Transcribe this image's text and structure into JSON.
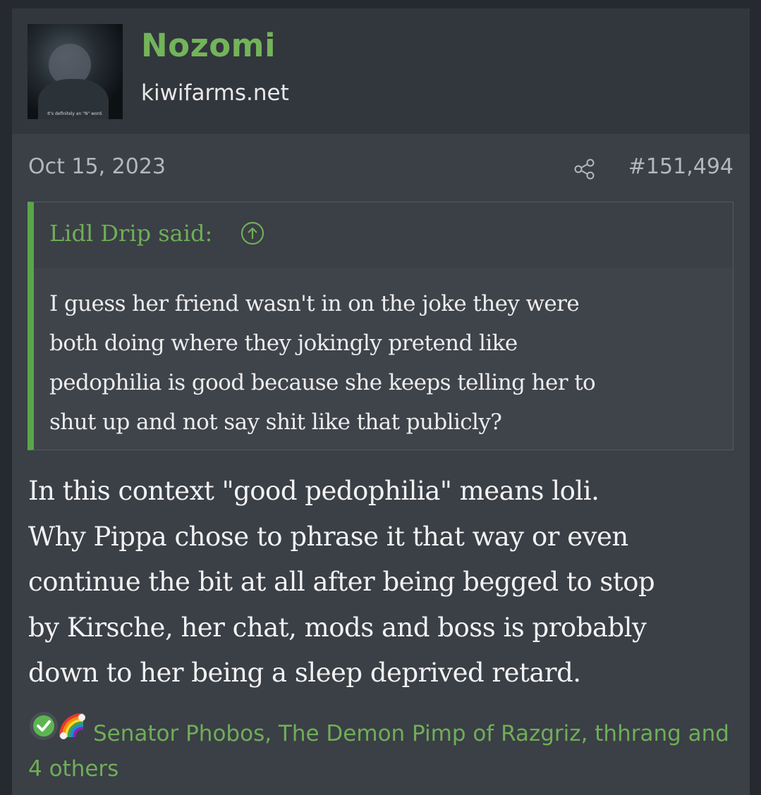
{
  "user": {
    "name": "Nozomi",
    "site": "kiwifarms.net",
    "avatar_caption": "It's definitely an \"N\" word."
  },
  "post": {
    "date": "Oct 15, 2023",
    "number": "#151,494",
    "share_icon": "share-icon"
  },
  "quote": {
    "author": "Lidl Drip said:",
    "arrow_icon": "arrow-up-circle-icon",
    "lines": [
      "I guess her friend wasn't in on the joke they were",
      "both doing where they jokingly pretend like",
      "pedophilia is good because she keeps telling her to",
      "shut up and not say shit like that publicly?"
    ]
  },
  "message": {
    "lines": [
      "In this context \"good pedophilia\" means loli.",
      "Why Pippa chose to phrase it that way or even",
      "continue the bit at all after being begged to stop",
      "by Kirsche, her chat, mods and boss is probably",
      "down to her being a sleep deprived retard."
    ]
  },
  "reactions": {
    "icons": [
      "check-icon",
      "rainbow-icon"
    ],
    "text": "Senator Phobos, The Demon Pimp of Razgriz, thhrang and 4 others"
  },
  "colors": {
    "accent_green": "#73b45a",
    "quote_bar": "#59a64a",
    "background": "#3b3f46"
  }
}
